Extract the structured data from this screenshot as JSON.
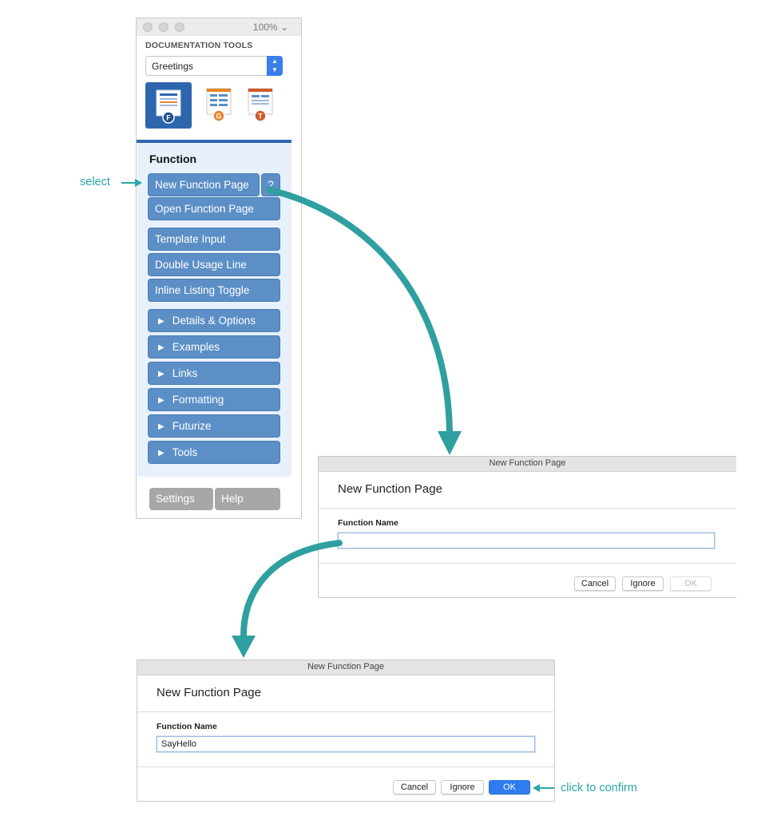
{
  "palette": {
    "zoom": "100%",
    "header": "DOCUMENTATION TOOLS",
    "notebook_select": "Greetings",
    "modes": [
      {
        "name": "function",
        "badge": "F",
        "active": true
      },
      {
        "name": "guide",
        "badge": "G",
        "active": false
      },
      {
        "name": "tutorial",
        "badge": "T",
        "active": false
      }
    ],
    "section_title": "Function",
    "buttons": {
      "new_function_page": "New Function Page",
      "help_glyph": "?",
      "open_function_page": "Open Function Page",
      "template_input": "Template Input",
      "double_usage_line": "Double Usage Line",
      "inline_listing_toggle": "Inline Listing Toggle"
    },
    "groups": [
      "Details & Options",
      "Examples",
      "Links",
      "Formatting",
      "Futurize",
      "Tools"
    ],
    "footer": {
      "settings": "Settings",
      "help": "Help"
    }
  },
  "dialog_empty": {
    "window_title": "New Function Page",
    "heading": "New Function Page",
    "field_label": "Function Name",
    "field_value": "",
    "buttons": {
      "cancel": "Cancel",
      "ignore": "Ignore",
      "ok": "OK"
    },
    "ok_enabled": false
  },
  "dialog_filled": {
    "window_title": "New Function Page",
    "heading": "New Function Page",
    "field_label": "Function Name",
    "field_value": "SayHello",
    "buttons": {
      "cancel": "Cancel",
      "ignore": "Ignore",
      "ok": "OK"
    },
    "ok_enabled": true
  },
  "annotations": {
    "select": "select",
    "confirm": "click to confirm"
  },
  "colors": {
    "palette_button": "#5b8fc6",
    "palette_accent": "#2e66ad",
    "annotation": "#2aa6a8",
    "ok_button": "#2f7cf0",
    "badge_f": "#2e66ad",
    "badge_g": "#e5852c",
    "badge_t": "#cf5a2a"
  }
}
